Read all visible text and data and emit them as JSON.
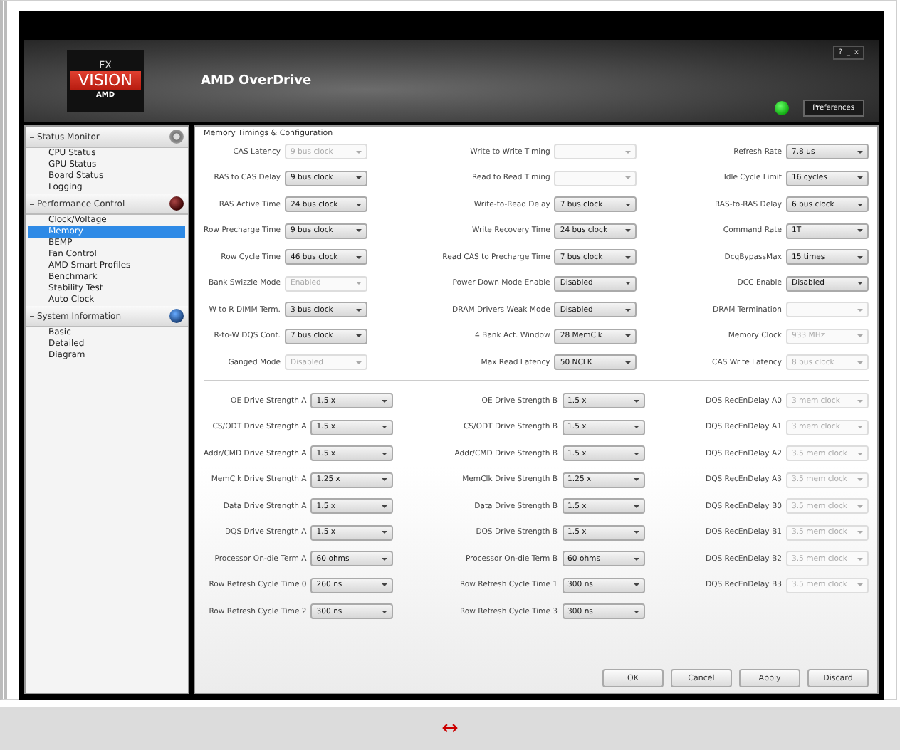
{
  "header": {
    "logo": {
      "top": "FX",
      "middle": "VISION",
      "bottom": "AMD"
    },
    "title": "AMD OverDrive",
    "window_controls": [
      "?",
      "_",
      "x"
    ],
    "status_on": true,
    "preferences_button": "Preferences"
  },
  "sidebar": [
    {
      "label": "Status Monitor",
      "expanded": true,
      "items": [
        {
          "label": "CPU Status",
          "selected": false
        },
        {
          "label": "GPU Status",
          "selected": false
        },
        {
          "label": "Board Status",
          "selected": false
        },
        {
          "label": "Logging",
          "selected": false
        }
      ]
    },
    {
      "label": "Performance Control",
      "expanded": true,
      "items": [
        {
          "label": "Clock/Voltage",
          "selected": false
        },
        {
          "label": "Memory",
          "selected": true
        },
        {
          "label": "BEMP",
          "selected": false
        },
        {
          "label": "Fan Control",
          "selected": false
        },
        {
          "label": "AMD Smart Profiles",
          "selected": false
        },
        {
          "label": "Benchmark",
          "selected": false
        },
        {
          "label": "Stability Test",
          "selected": false
        },
        {
          "label": "Auto Clock",
          "selected": false
        }
      ]
    },
    {
      "label": "System Information",
      "expanded": true,
      "items": [
        {
          "label": "Basic",
          "selected": false
        },
        {
          "label": "Detailed",
          "selected": false
        },
        {
          "label": "Diagram",
          "selected": false
        }
      ]
    }
  ],
  "panel_title": "Memory Timings & Configuration",
  "sections": [
    {
      "columns": [
        [
          {
            "label": "CAS Latency",
            "value": "9 bus clock",
            "disabled": true
          },
          {
            "label": "RAS to CAS Delay",
            "value": "9 bus clock",
            "disabled": false
          },
          {
            "label": "RAS Active Time",
            "value": "24 bus clock",
            "disabled": false
          },
          {
            "label": "Row Precharge Time",
            "value": "9 bus clock",
            "disabled": false
          },
          {
            "label": "Row Cycle Time",
            "value": "46 bus clock",
            "disabled": false
          },
          {
            "label": "Bank Swizzle Mode",
            "value": "Enabled",
            "disabled": true
          },
          {
            "label": "W to R DIMM Term.",
            "value": "3 bus clock",
            "disabled": false
          },
          {
            "label": "R-to-W DQS Cont.",
            "value": "7 bus clock",
            "disabled": false
          },
          {
            "label": "Ganged Mode",
            "value": "Disabled",
            "disabled": true
          }
        ],
        [
          {
            "label": "Write to Write Timing",
            "disabled": true
          },
          {
            "label": "Read to Read Timing",
            "disabled": true
          },
          {
            "label": "Write-to-Read Delay",
            "value": "7 bus clock",
            "disabled": false
          },
          {
            "label": "Write Recovery Time",
            "value": "24 bus clock",
            "disabled": false
          },
          {
            "label": "Read CAS to Precharge Time",
            "value": "7 bus clock",
            "disabled": false
          },
          {
            "label": "Power Down Mode Enable",
            "value": "Disabled",
            "disabled": false
          },
          {
            "label": "DRAM Drivers Weak Mode",
            "value": "Disabled",
            "disabled": false
          },
          {
            "label": "4 Bank Act. Window",
            "value": "28 MemClk",
            "disabled": false
          },
          {
            "label": "Max Read Latency",
            "value": "50 NCLK",
            "disabled": false
          }
        ],
        [
          {
            "label": "Refresh Rate",
            "value": "7.8 us",
            "disabled": false
          },
          {
            "label": "Idle Cycle Limit",
            "value": "16 cycles",
            "disabled": false
          },
          {
            "label": "RAS-to-RAS Delay",
            "value": "6 bus clock",
            "disabled": false
          },
          {
            "label": "Command Rate",
            "value": "1T",
            "disabled": false
          },
          {
            "label": "DcqBypassMax",
            "value": "15 times",
            "disabled": false
          },
          {
            "label": "DCC Enable",
            "value": "Disabled",
            "disabled": false
          },
          {
            "label": "DRAM Termination",
            "disabled": true
          },
          {
            "label": "Memory Clock",
            "value": "933 MHz",
            "disabled": true
          },
          {
            "label": "CAS Write Latency",
            "value": "8 bus clock",
            "disabled": true
          }
        ]
      ]
    },
    {
      "columns": [
        [
          {
            "label": "OE Drive Strength A",
            "value": "1.5 x",
            "disabled": false
          },
          {
            "label": "CS/ODT Drive Strength A",
            "value": "1.5 x",
            "disabled": false
          },
          {
            "label": "Addr/CMD Drive Strength A",
            "value": "1.5 x",
            "disabled": false
          },
          {
            "label": "MemClk Drive Strength A",
            "value": "1.25 x",
            "disabled": false
          },
          {
            "label": "Data Drive Strength A",
            "value": "1.5 x",
            "disabled": false
          },
          {
            "label": "DQS Drive Strength A",
            "value": "1.5 x",
            "disabled": false
          },
          {
            "label": "Processor On-die Term A",
            "value": "60 ohms",
            "disabled": false
          },
          {
            "label": "Row Refresh Cycle Time 0",
            "value": "260 ns",
            "disabled": false
          },
          {
            "label": "Row Refresh Cycle Time 2",
            "value": "300 ns",
            "disabled": false
          }
        ],
        [
          {
            "label": "OE Drive Strength B",
            "value": "1.5 x",
            "disabled": false
          },
          {
            "label": "CS/ODT Drive Strength B",
            "value": "1.5 x",
            "disabled": false
          },
          {
            "label": "Addr/CMD Drive Strength B",
            "value": "1.5 x",
            "disabled": false
          },
          {
            "label": "MemClk Drive Strength B",
            "value": "1.25 x",
            "disabled": false
          },
          {
            "label": "Data Drive Strength B",
            "value": "1.5 x",
            "disabled": false
          },
          {
            "label": "DQS Drive Strength B",
            "value": "1.5 x",
            "disabled": false
          },
          {
            "label": "Processor On-die Term B",
            "value": "60 ohms",
            "disabled": false
          },
          {
            "label": "Row Refresh Cycle Time 1",
            "value": "300 ns",
            "disabled": false
          },
          {
            "label": "Row Refresh Cycle Time 3",
            "value": "300 ns",
            "disabled": false
          }
        ],
        [
          {
            "label": "DQS RecEnDelay A0",
            "value": "3 mem clock",
            "disabled": true
          },
          {
            "label": "DQS RecEnDelay A1",
            "value": "3 mem clock",
            "disabled": true
          },
          {
            "label": "DQS RecEnDelay A2",
            "value": "3.5 mem clock",
            "disabled": true
          },
          {
            "label": "DQS RecEnDelay A3",
            "value": "3.5 mem clock",
            "disabled": true
          },
          {
            "label": "DQS RecEnDelay B0",
            "value": "3.5 mem clock",
            "disabled": true
          },
          {
            "label": "DQS RecEnDelay B1",
            "value": "3.5 mem clock",
            "disabled": true
          },
          {
            "label": "DQS RecEnDelay B2",
            "value": "3.5 mem clock",
            "disabled": true
          },
          {
            "label": "DQS RecEnDelay B3",
            "value": "3.5 mem clock",
            "disabled": true
          }
        ]
      ]
    }
  ],
  "buttons": [
    "OK",
    "Cancel",
    "Apply",
    "Discard"
  ],
  "footer_symbol": "↔"
}
